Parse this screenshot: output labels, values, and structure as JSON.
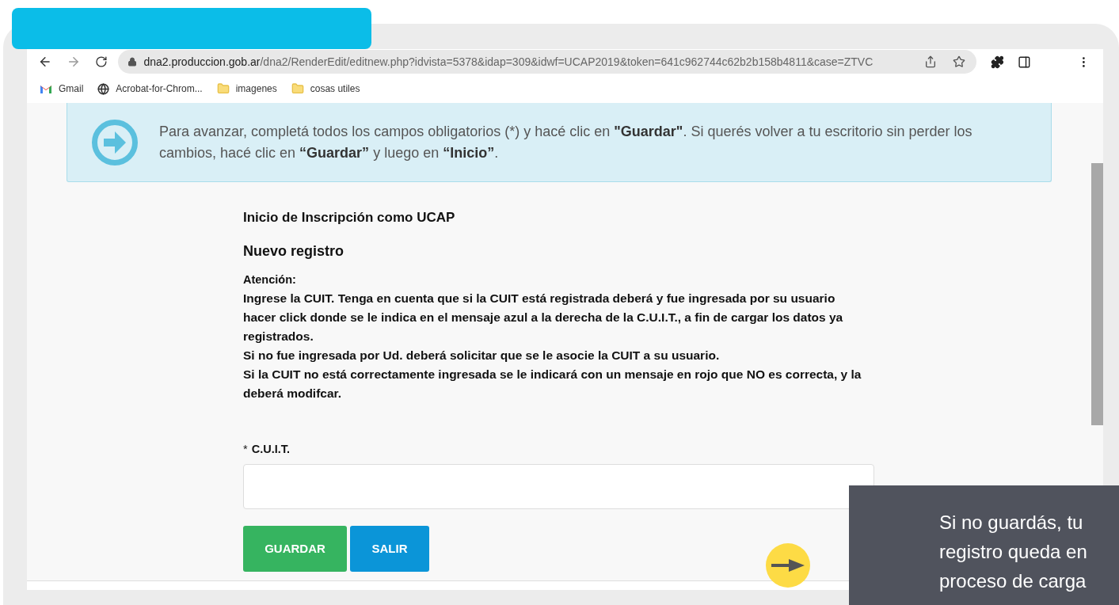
{
  "browser": {
    "url": {
      "domain": "dna2.produccion.gob.ar",
      "path": "/dna2/RenderEdit/editnew.php?idvista=5378&idap=309&idwf=UCAP2019&token=641c962744c62b2b158b4811&case=ZTVC"
    },
    "bookmarks": [
      {
        "label": "Gmail",
        "kind": "gmail"
      },
      {
        "label": "Acrobat-for-Chrom...",
        "kind": "globe"
      },
      {
        "label": "imagenes",
        "kind": "folder"
      },
      {
        "label": "cosas utiles",
        "kind": "folder"
      }
    ]
  },
  "banner": {
    "text": "Para avanzar, completá todos los campos obligatorios (*) y hacé clic en **\"Guardar\"**. Si querés volver a tu escritorio sin perder los cambios, hacé clic en **“Guardar”** y luego en **“Inicio”**."
  },
  "form": {
    "title": "Inicio de Inscripción como UCAP",
    "subtitle": "Nuevo registro",
    "attention_heading": "Atención:",
    "attention_lines": [
      "Ingrese la CUIT. Tenga en cuenta que si la CUIT está registrada deberá y fue ingresada por su usuario hacer click donde se le indica en el mensaje azul a la derecha de la C.U.I.T., a fin de cargar los datos ya registrados.",
      "Si no fue ingresada por Ud. deberá solicitar que se le asocie la CUIT a su usuario.",
      "Si la CUIT no está correctamente ingresada se le indicará con un mensaje en rojo que NO es correcta, y la deberá modifcar."
    ],
    "field": {
      "required_mark": "*",
      "label": "C.U.I.T."
    },
    "buttons": [
      {
        "label": "GUARDAR",
        "kind": "primary"
      },
      {
        "label": "SALIR",
        "kind": "secondary"
      }
    ]
  },
  "callout": {
    "text": "Si no guardás, tu registro queda en proceso de carga"
  }
}
